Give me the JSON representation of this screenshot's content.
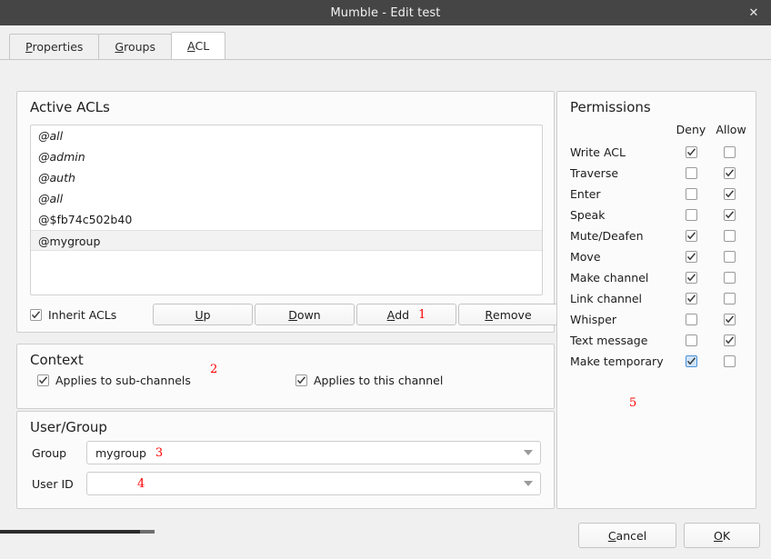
{
  "window": {
    "title": "Mumble - Edit test",
    "close_label": "✕"
  },
  "tabs": [
    {
      "label": "Properties",
      "mnemonic": "P",
      "active": false
    },
    {
      "label": "Groups",
      "mnemonic": "G",
      "active": false
    },
    {
      "label": "ACL",
      "mnemonic": "A",
      "active": true
    }
  ],
  "active_acls": {
    "title": "Active ACLs",
    "entries": [
      {
        "label": "@all",
        "inherited": true,
        "selected": false
      },
      {
        "label": "@admin",
        "inherited": true,
        "selected": false
      },
      {
        "label": "@auth",
        "inherited": true,
        "selected": false
      },
      {
        "label": "@all",
        "inherited": true,
        "selected": false
      },
      {
        "label": "@$fb74c502b40",
        "inherited": false,
        "selected": false
      },
      {
        "label": "@mygroup",
        "inherited": false,
        "selected": true
      }
    ],
    "inherit_label": "Inherit ACLs",
    "inherit_checked": true,
    "buttons": {
      "up": "Up",
      "down": "Down",
      "add": "Add",
      "remove": "Remove"
    }
  },
  "context": {
    "title": "Context",
    "sub_channels_label": "Applies to sub-channels",
    "sub_channels_checked": true,
    "this_channel_label": "Applies to this channel",
    "this_channel_checked": true
  },
  "user_group": {
    "title": "User/Group",
    "group_label": "Group",
    "group_value": "mygroup",
    "user_id_label": "User ID",
    "user_id_value": ""
  },
  "permissions": {
    "title": "Permissions",
    "col_deny": "Deny",
    "col_allow": "Allow",
    "rows": [
      {
        "name": "Write ACL",
        "deny": true,
        "allow": false,
        "focused": false
      },
      {
        "name": "Traverse",
        "deny": false,
        "allow": true,
        "focused": false
      },
      {
        "name": "Enter",
        "deny": false,
        "allow": true,
        "focused": false
      },
      {
        "name": "Speak",
        "deny": false,
        "allow": true,
        "focused": false
      },
      {
        "name": "Mute/Deafen",
        "deny": true,
        "allow": false,
        "focused": false
      },
      {
        "name": "Move",
        "deny": true,
        "allow": false,
        "focused": false
      },
      {
        "name": "Make channel",
        "deny": true,
        "allow": false,
        "focused": false
      },
      {
        "name": "Link channel",
        "deny": true,
        "allow": false,
        "focused": false
      },
      {
        "name": "Whisper",
        "deny": false,
        "allow": true,
        "focused": false
      },
      {
        "name": "Text message",
        "deny": false,
        "allow": true,
        "focused": false
      },
      {
        "name": "Make temporary",
        "deny": true,
        "allow": false,
        "focused": true
      }
    ]
  },
  "dialog_buttons": {
    "cancel": "Cancel",
    "cancel_mnemonic": "C",
    "ok": "OK",
    "ok_mnemonic": "O"
  },
  "annotations": [
    {
      "id": "1",
      "text": "1"
    },
    {
      "id": "2",
      "text": "2"
    },
    {
      "id": "3",
      "text": "3"
    },
    {
      "id": "4",
      "text": "4"
    },
    {
      "id": "5",
      "text": "5"
    }
  ],
  "colors": {
    "titlebar_bg": "#454545",
    "dialog_bg": "#f0f0f0",
    "groupbox_bg": "#fbfbfb",
    "annotation_red": "#ff0000",
    "focus_blue": "#4a90d9"
  }
}
